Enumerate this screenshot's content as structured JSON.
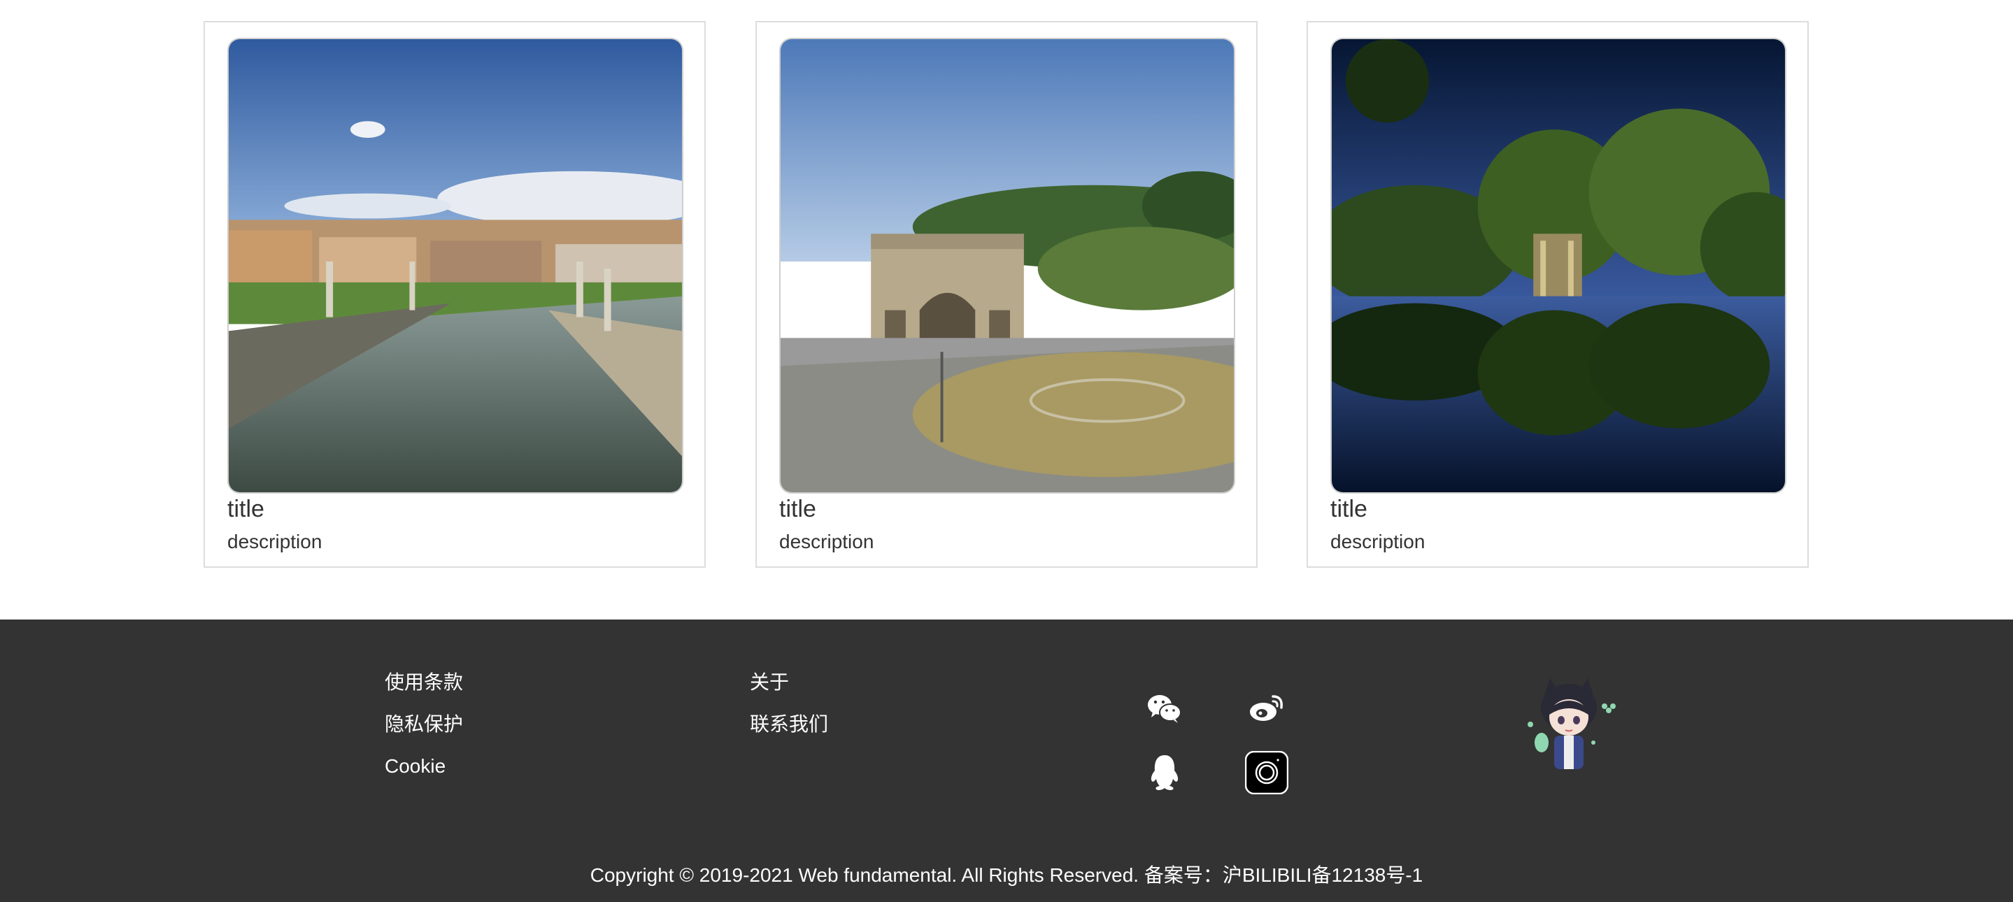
{
  "cards": [
    {
      "title": "title",
      "description": "description",
      "image_alt": "canal-with-statues-photo"
    },
    {
      "title": "title",
      "description": "description",
      "image_alt": "triumphal-arch-photo"
    },
    {
      "title": "title",
      "description": "description",
      "image_alt": "lake-temple-reflection-photo"
    }
  ],
  "footer": {
    "links_col1": [
      "使用条款",
      "隐私保护",
      "Cookie"
    ],
    "links_col2": [
      "关于",
      "联系我们"
    ],
    "social_icons": [
      "wechat-icon",
      "weibo-icon",
      "qq-icon",
      "instagram-icon"
    ],
    "copyright": "Copyright © 2019-2021 Web fundamental. All Rights Reserved. 备案号：沪BILIBILI备12138号-1"
  },
  "colors": {
    "footer_bg": "#333333",
    "footer_text": "#ffffff",
    "card_border": "#dddddd"
  }
}
